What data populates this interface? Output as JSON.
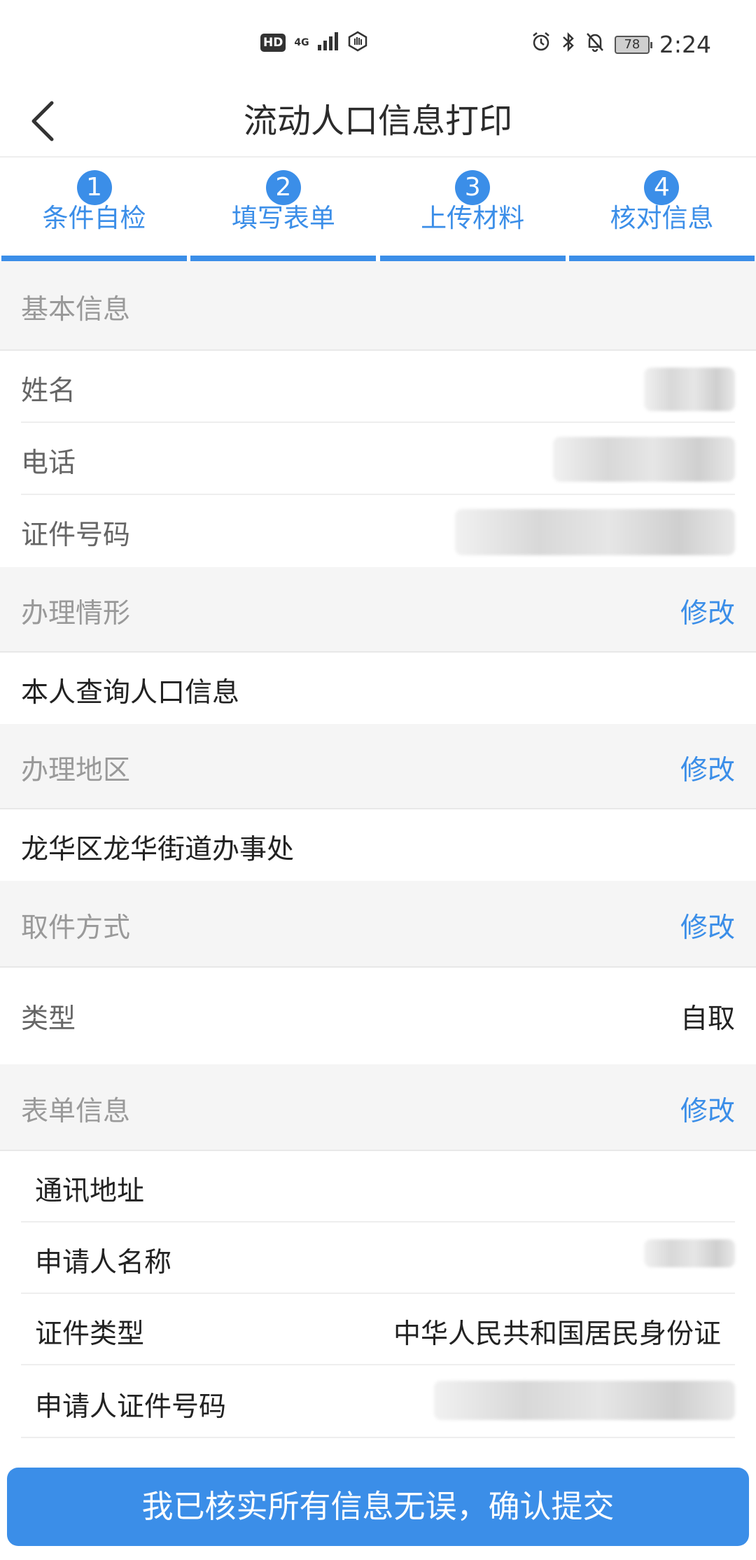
{
  "status_bar": {
    "hd": "HD",
    "network": "4G",
    "battery": "78",
    "time": "2:24"
  },
  "header": {
    "title": "流动人口信息打印"
  },
  "steps": [
    {
      "num": "1",
      "label": "条件自检"
    },
    {
      "num": "2",
      "label": "填写表单"
    },
    {
      "num": "3",
      "label": "上传材料"
    },
    {
      "num": "4",
      "label": "核对信息"
    }
  ],
  "basic_info": {
    "title": "基本信息",
    "name_label": "姓名",
    "phone_label": "电话",
    "id_label": "证件号码"
  },
  "situation": {
    "title": "办理情形",
    "edit": "修改",
    "value": "本人查询人口信息"
  },
  "region": {
    "title": "办理地区",
    "edit": "修改",
    "value": "龙华区龙华街道办事处"
  },
  "pickup": {
    "title": "取件方式",
    "edit": "修改",
    "type_label": "类型",
    "type_value": "自取"
  },
  "form_info": {
    "title": "表单信息",
    "edit": "修改",
    "address_label": "通讯地址",
    "applicant_label": "申请人名称",
    "id_type_label": "证件类型",
    "id_type_value": "中华人民共和国居民身份证",
    "applicant_id_label": "申请人证件号码"
  },
  "submit": {
    "label": "我已核实所有信息无误，确认提交"
  },
  "colors": {
    "accent": "#3b8ee8",
    "section_bg": "#f5f5f5"
  }
}
